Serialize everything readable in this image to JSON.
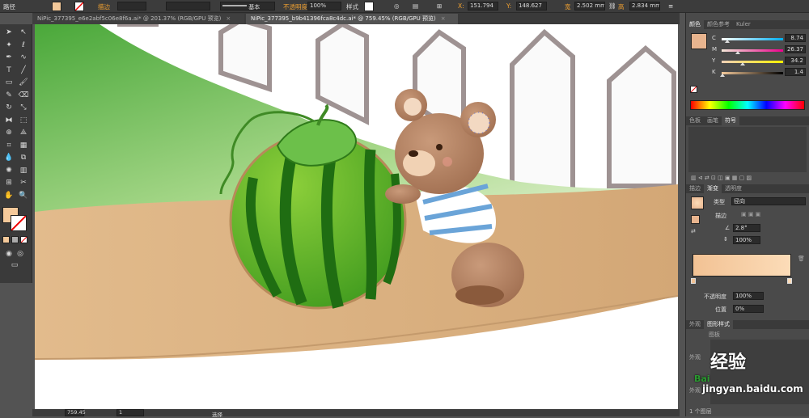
{
  "control_bar": {
    "object_type": "路径",
    "stroke_label": "描边",
    "brush_label": "基本",
    "opacity_label": "不透明度",
    "opacity_value": "100%",
    "style_label": "样式",
    "x_label": "X:",
    "x_value": "151.794",
    "y_label": "Y:",
    "y_value": "148.627",
    "w_label": "宽",
    "w_value": "2.502 mm",
    "h_label": "高",
    "h_value": "2.834 mm",
    "fill_color": "#f4c99a"
  },
  "doc_tabs": [
    {
      "label": "NiPic_377395_e6e2abf5c06e8f6a.ai* @ 201.37% (RGB/GPU 预览)",
      "close": "×"
    },
    {
      "label": "NiPic_377395_b9b41396fca8c4dc.ai* @ 759.45% (RGB/GPU 预览)",
      "close": "×"
    }
  ],
  "toolbar": {
    "icons": [
      "selection-tool-icon",
      "direct-selection-tool-icon",
      "magic-wand-icon",
      "lasso-icon",
      "pen-tool-icon",
      "curvature-icon",
      "type-tool-icon",
      "line-tool-icon",
      "rectangle-tool-icon",
      "paintbrush-icon",
      "pencil-icon",
      "eraser-icon",
      "rotate-icon",
      "scale-icon",
      "width-tool-icon",
      "free-transform-icon",
      "shape-builder-icon",
      "perspective-icon",
      "mesh-icon",
      "gradient-icon",
      "eyedropper-icon",
      "blend-icon",
      "symbol-sprayer-icon",
      "column-graph-icon",
      "artboard-icon",
      "slice-icon",
      "hand-icon",
      "zoom-icon"
    ],
    "fill_color": "#f4c99a"
  },
  "status_bar": {
    "zoom": "759.45",
    "artboard": "1",
    "mode": "选择"
  },
  "color_panel": {
    "tabs": [
      "颜色",
      "颜色参考",
      "Kuler"
    ],
    "swatch": "#e8b48e",
    "channels": [
      {
        "name": "C",
        "value": "8.74",
        "pct": 0.087,
        "from": "#ffffff",
        "to": "#00aeef"
      },
      {
        "name": "M",
        "value": "26.37",
        "pct": 0.264,
        "from": "#f4e8d8",
        "to": "#ec008c"
      },
      {
        "name": "Y",
        "value": "34.2",
        "pct": 0.342,
        "from": "#f0d0b8",
        "to": "#fff200"
      },
      {
        "name": "K",
        "value": "1.4",
        "pct": 0.014,
        "from": "#f4c99a",
        "to": "#000000"
      }
    ]
  },
  "swatches_panel": {
    "tabs": [
      "色板",
      "画笔",
      "符号"
    ]
  },
  "gradient_panel": {
    "tabs": [
      "描边",
      "渐变",
      "透明度"
    ],
    "type_label": "类型",
    "type_value": "径向",
    "stroke_label": "描边",
    "angle_value": "2.8°",
    "aspect_value": "100%",
    "start_color": "#f2c294",
    "end_color": "#fcdcb8",
    "opacity_label": "不透明度",
    "opacity_value": "100%",
    "location_label": "位置",
    "location_value": "0%"
  },
  "appearance_panel": {
    "tabs": [
      "外观",
      "图形样式"
    ],
    "sub_label": "图板",
    "side_label_1": "外观",
    "side_label_2": "外观",
    "footer": "1 个图层"
  },
  "watermark": {
    "title": "经验",
    "site": "jingyan.baidu.com",
    "brand": "Bai"
  }
}
